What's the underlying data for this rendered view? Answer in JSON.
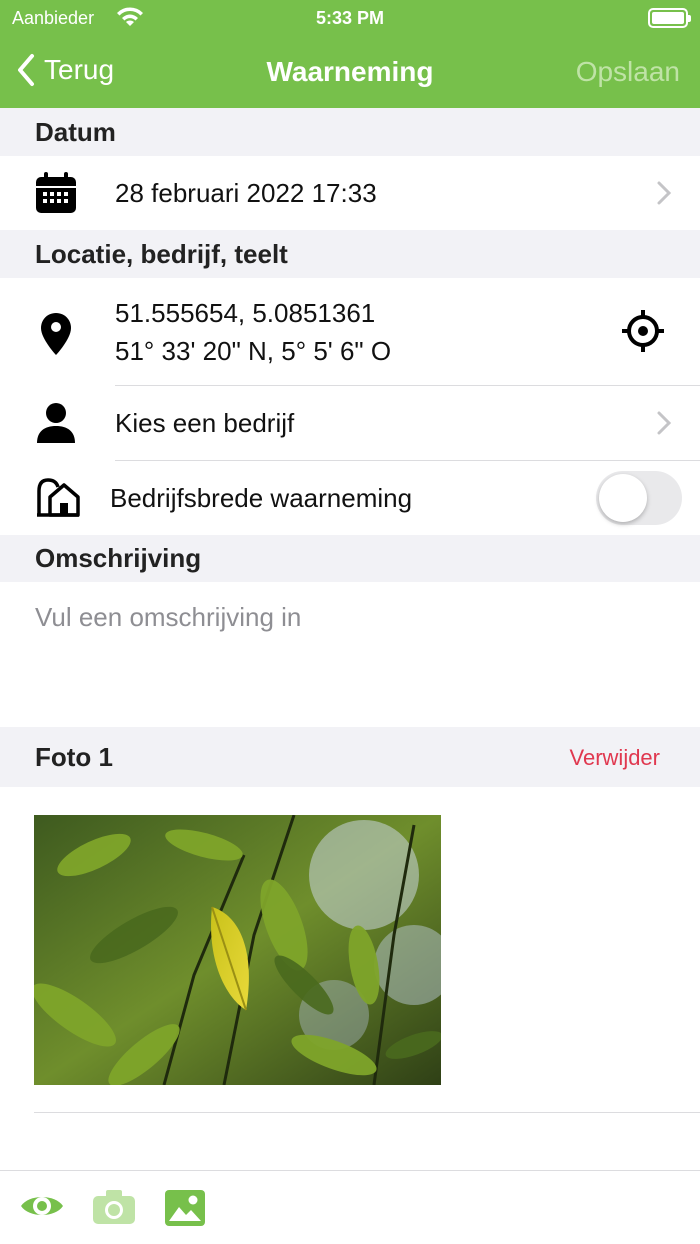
{
  "status": {
    "carrier": "Aanbieder",
    "time": "5:33 PM"
  },
  "nav": {
    "back_label": "Terug",
    "title": "Waarneming",
    "save_label": "Opslaan"
  },
  "sections": {
    "date_header": "Datum",
    "location_header": "Locatie, bedrijf, teelt",
    "description_header": "Omschrijving"
  },
  "date": {
    "value": "28 februari 2022 17:33",
    "icon": "calendar-icon"
  },
  "location": {
    "coords": "51.555654, 5.0851361",
    "coords_dms": "51° 33' 20\" N, 5° 5' 6\" O",
    "icon": "map-pin-icon",
    "action_icon": "crosshair-icon"
  },
  "company": {
    "label": "Kies een bedrijf",
    "icon": "person-icon"
  },
  "company_wide": {
    "label": "Bedrijfsbrede waarneming",
    "icon": "building-icon",
    "enabled": false
  },
  "description": {
    "placeholder": "Vul een omschrijving in"
  },
  "photo": {
    "label": "Foto 1",
    "delete_label": "Verwijder"
  },
  "colors": {
    "accent": "#77c04b",
    "accent_light": "#bfe3a6",
    "danger": "#e0384f",
    "secondary_text": "#8e8e93",
    "section_bg": "#f2f2f6"
  },
  "toolbar": {
    "icons": [
      "eye-icon",
      "camera-icon",
      "image-icon"
    ]
  }
}
